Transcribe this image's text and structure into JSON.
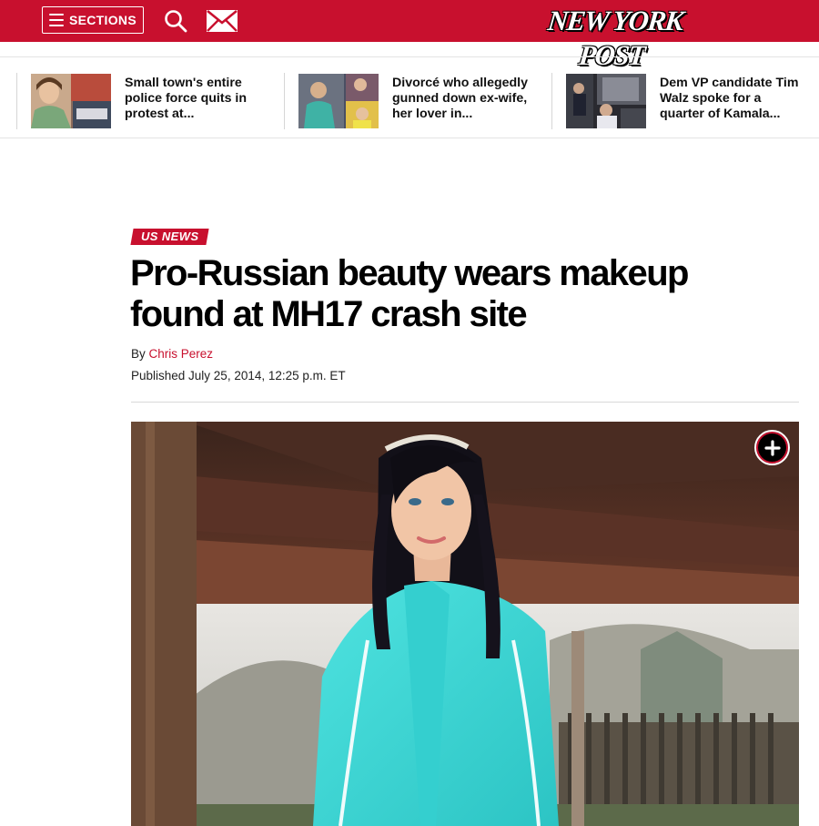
{
  "header": {
    "sections_label": "SECTIONS",
    "logo_text": "NEW YORK POST",
    "icons": [
      "menu-icon",
      "search-icon",
      "mail-icon"
    ],
    "brand_color": "#c8102e"
  },
  "trending": [
    {
      "text": "Small town's entire police force quits in protest at..."
    },
    {
      "text": "Divorcé who allegedly gunned down ex-wife, her lover in..."
    },
    {
      "text": "Dem VP candidate Tim Walz spoke for a quarter of Kamala..."
    }
  ],
  "article": {
    "kicker": "US NEWS",
    "headline": "Pro-Russian beauty wears makeup found at MH17 crash site",
    "byline_prefix": "By",
    "author": "Chris Perez",
    "published": "Published July 25, 2014, 12:25 p.m. ET",
    "photo_icon": "plus-icon"
  }
}
